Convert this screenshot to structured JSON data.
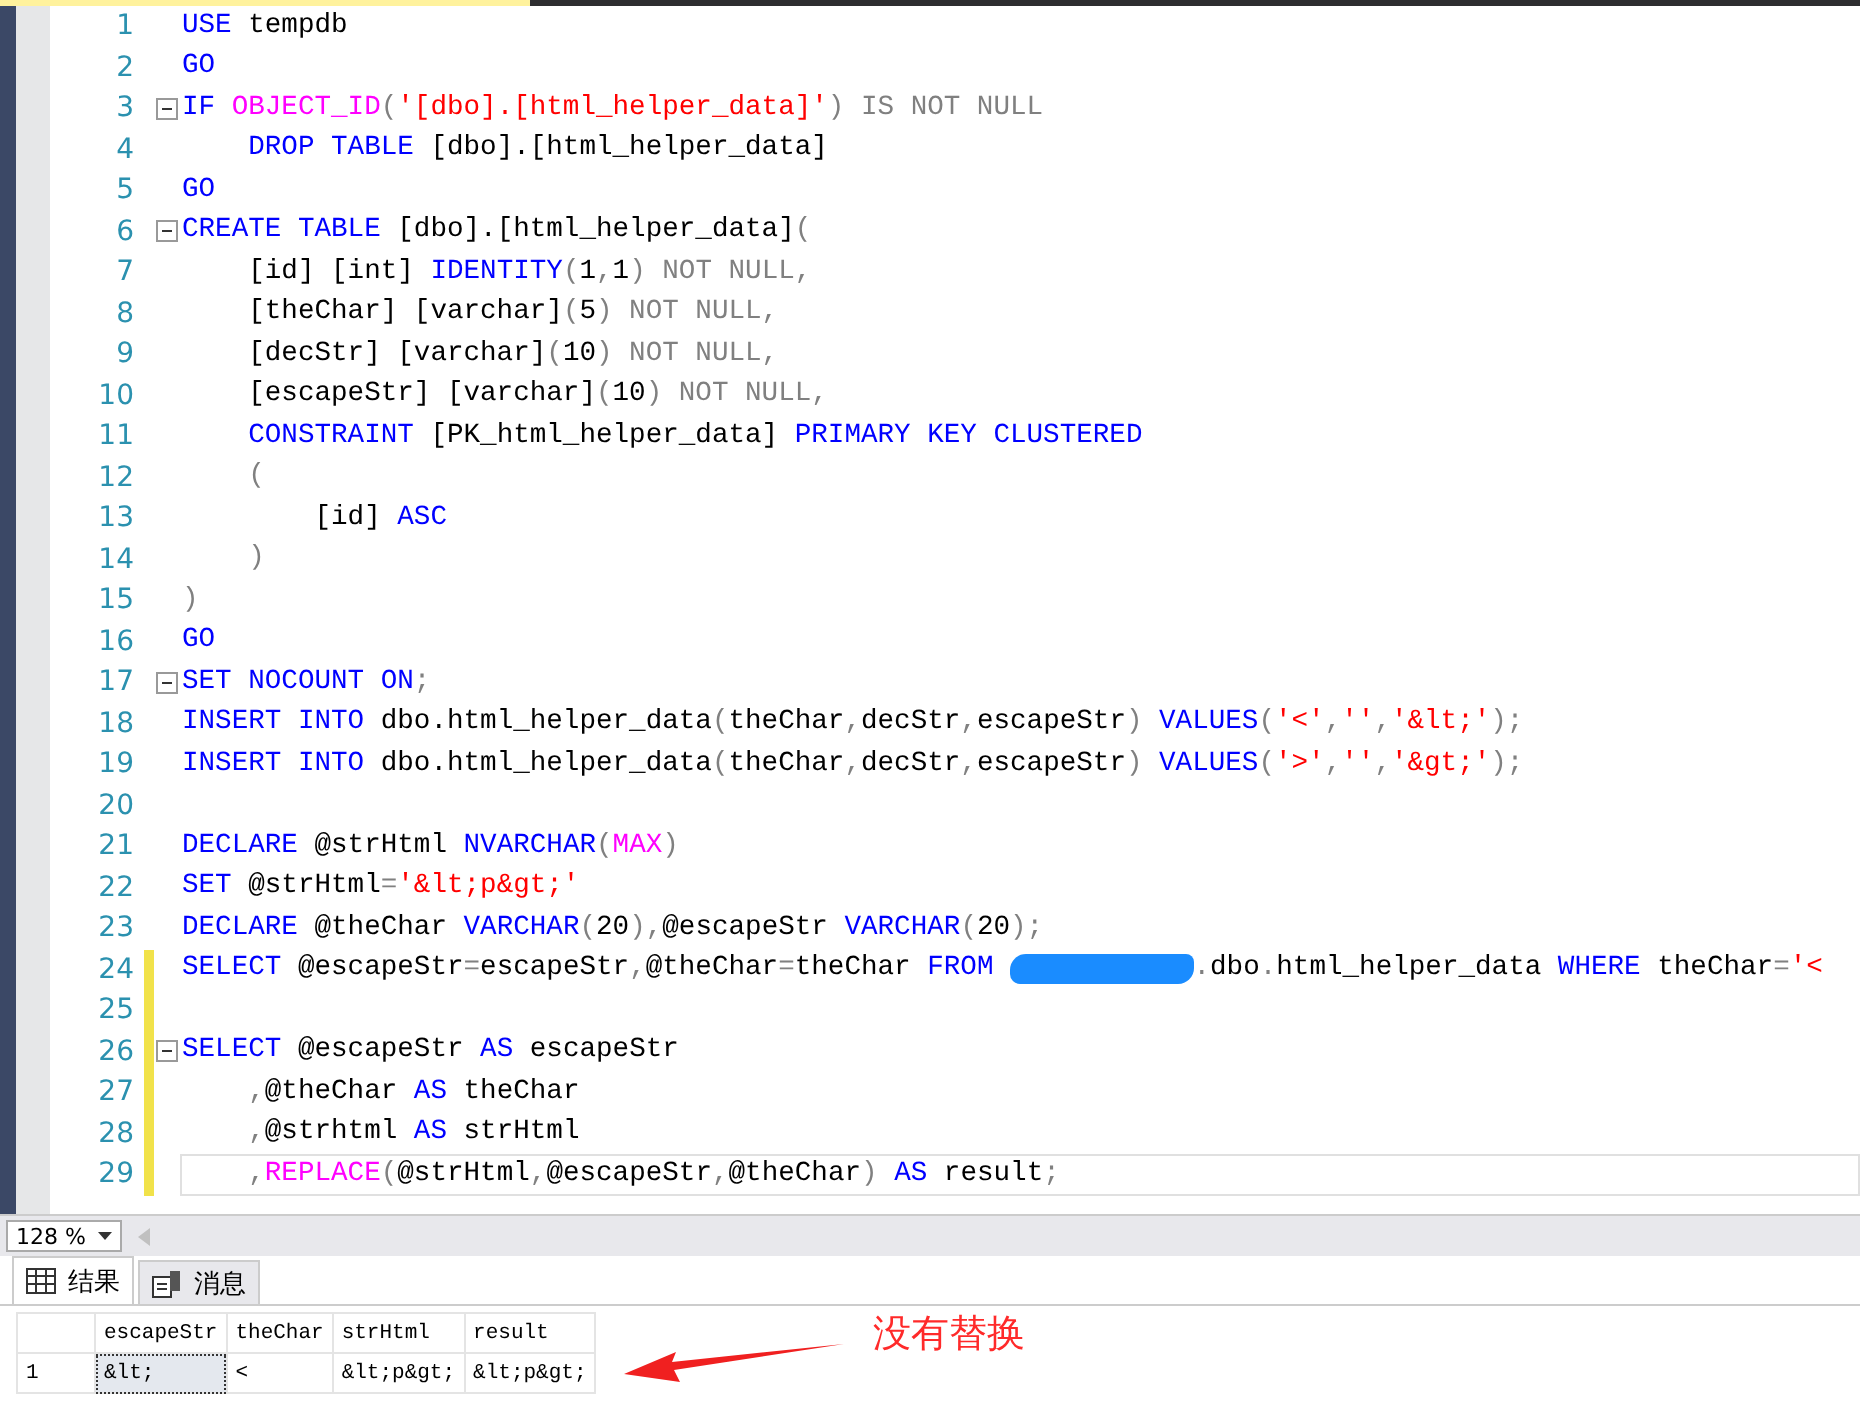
{
  "editor": {
    "lines": [
      {
        "number": "1",
        "fold": false,
        "changed": false,
        "current": false,
        "tokens": [
          {
            "kind": "keyword",
            "text": "USE"
          },
          {
            "kind": "plain",
            "text": " tempdb"
          }
        ]
      },
      {
        "number": "2",
        "fold": false,
        "changed": false,
        "current": false,
        "tokens": [
          {
            "kind": "keyword",
            "text": "GO"
          }
        ]
      },
      {
        "number": "3",
        "fold": true,
        "changed": false,
        "current": false,
        "tokens": [
          {
            "kind": "keyword",
            "text": "IF "
          },
          {
            "kind": "function",
            "text": "OBJECT_ID"
          },
          {
            "kind": "gray",
            "text": "("
          },
          {
            "kind": "string",
            "text": "'[dbo].[html_helper_data]'"
          },
          {
            "kind": "gray",
            "text": ") IS NOT NULL"
          }
        ]
      },
      {
        "number": "4",
        "fold": false,
        "changed": false,
        "current": false,
        "tokens": [
          {
            "kind": "keyword",
            "text": "    DROP TABLE"
          },
          {
            "kind": "plain",
            "text": " [dbo].[html_helper_data]"
          }
        ]
      },
      {
        "number": "5",
        "fold": false,
        "changed": false,
        "current": false,
        "tokens": [
          {
            "kind": "keyword",
            "text": "GO"
          }
        ]
      },
      {
        "number": "6",
        "fold": true,
        "changed": false,
        "current": false,
        "tokens": [
          {
            "kind": "keyword",
            "text": "CREATE TABLE"
          },
          {
            "kind": "plain",
            "text": " [dbo].[html_helper_data]"
          },
          {
            "kind": "gray",
            "text": "("
          }
        ]
      },
      {
        "number": "7",
        "fold": false,
        "changed": false,
        "current": false,
        "tokens": [
          {
            "kind": "plain",
            "text": "    [id] [int] "
          },
          {
            "kind": "keyword",
            "text": "IDENTITY"
          },
          {
            "kind": "gray",
            "text": "("
          },
          {
            "kind": "plain",
            "text": "1"
          },
          {
            "kind": "gray",
            "text": ","
          },
          {
            "kind": "plain",
            "text": "1"
          },
          {
            "kind": "gray",
            "text": ") NOT NULL,"
          }
        ]
      },
      {
        "number": "8",
        "fold": false,
        "changed": false,
        "current": false,
        "tokens": [
          {
            "kind": "plain",
            "text": "    [theChar] [varchar]"
          },
          {
            "kind": "gray",
            "text": "("
          },
          {
            "kind": "plain",
            "text": "5"
          },
          {
            "kind": "gray",
            "text": ") NOT NULL,"
          }
        ]
      },
      {
        "number": "9",
        "fold": false,
        "changed": false,
        "current": false,
        "tokens": [
          {
            "kind": "plain",
            "text": "    [decStr] [varchar]"
          },
          {
            "kind": "gray",
            "text": "("
          },
          {
            "kind": "plain",
            "text": "10"
          },
          {
            "kind": "gray",
            "text": ") NOT NULL,"
          }
        ]
      },
      {
        "number": "10",
        "fold": false,
        "changed": false,
        "current": false,
        "tokens": [
          {
            "kind": "plain",
            "text": "    [escapeStr] [varchar]"
          },
          {
            "kind": "gray",
            "text": "("
          },
          {
            "kind": "plain",
            "text": "10"
          },
          {
            "kind": "gray",
            "text": ") NOT NULL,"
          }
        ]
      },
      {
        "number": "11",
        "fold": false,
        "changed": false,
        "current": false,
        "tokens": [
          {
            "kind": "keyword",
            "text": "    CONSTRAINT"
          },
          {
            "kind": "plain",
            "text": " [PK_html_helper_data] "
          },
          {
            "kind": "keyword",
            "text": "PRIMARY KEY CLUSTERED"
          }
        ]
      },
      {
        "number": "12",
        "fold": false,
        "changed": false,
        "current": false,
        "tokens": [
          {
            "kind": "gray",
            "text": "    ("
          }
        ]
      },
      {
        "number": "13",
        "fold": false,
        "changed": false,
        "current": false,
        "tokens": [
          {
            "kind": "plain",
            "text": "        [id] "
          },
          {
            "kind": "keyword",
            "text": "ASC"
          }
        ]
      },
      {
        "number": "14",
        "fold": false,
        "changed": false,
        "current": false,
        "tokens": [
          {
            "kind": "gray",
            "text": "    )"
          }
        ]
      },
      {
        "number": "15",
        "fold": false,
        "changed": false,
        "current": false,
        "tokens": [
          {
            "kind": "gray",
            "text": ")"
          }
        ]
      },
      {
        "number": "16",
        "fold": false,
        "changed": false,
        "current": false,
        "tokens": [
          {
            "kind": "keyword",
            "text": "GO"
          }
        ]
      },
      {
        "number": "17",
        "fold": true,
        "changed": false,
        "current": false,
        "tokens": [
          {
            "kind": "keyword",
            "text": "SET NOCOUNT ON"
          },
          {
            "kind": "gray",
            "text": ";"
          }
        ]
      },
      {
        "number": "18",
        "fold": false,
        "changed": false,
        "current": false,
        "tokens": [
          {
            "kind": "keyword",
            "text": "INSERT INTO"
          },
          {
            "kind": "plain",
            "text": " dbo.html_helper_data"
          },
          {
            "kind": "gray",
            "text": "("
          },
          {
            "kind": "plain",
            "text": "theChar"
          },
          {
            "kind": "gray",
            "text": ","
          },
          {
            "kind": "plain",
            "text": "decStr"
          },
          {
            "kind": "gray",
            "text": ","
          },
          {
            "kind": "plain",
            "text": "escapeStr"
          },
          {
            "kind": "gray",
            "text": ") "
          },
          {
            "kind": "keyword",
            "text": "VALUES"
          },
          {
            "kind": "gray",
            "text": "("
          },
          {
            "kind": "string",
            "text": "'<'"
          },
          {
            "kind": "gray",
            "text": ","
          },
          {
            "kind": "string",
            "text": "''"
          },
          {
            "kind": "gray",
            "text": ","
          },
          {
            "kind": "string",
            "text": "'&lt;'"
          },
          {
            "kind": "gray",
            "text": ");"
          }
        ]
      },
      {
        "number": "19",
        "fold": false,
        "changed": false,
        "current": false,
        "tokens": [
          {
            "kind": "keyword",
            "text": "INSERT INTO"
          },
          {
            "kind": "plain",
            "text": " dbo.html_helper_data"
          },
          {
            "kind": "gray",
            "text": "("
          },
          {
            "kind": "plain",
            "text": "theChar"
          },
          {
            "kind": "gray",
            "text": ","
          },
          {
            "kind": "plain",
            "text": "decStr"
          },
          {
            "kind": "gray",
            "text": ","
          },
          {
            "kind": "plain",
            "text": "escapeStr"
          },
          {
            "kind": "gray",
            "text": ") "
          },
          {
            "kind": "keyword",
            "text": "VALUES"
          },
          {
            "kind": "gray",
            "text": "("
          },
          {
            "kind": "string",
            "text": "'>'"
          },
          {
            "kind": "gray",
            "text": ","
          },
          {
            "kind": "string",
            "text": "''"
          },
          {
            "kind": "gray",
            "text": ","
          },
          {
            "kind": "string",
            "text": "'&gt;'"
          },
          {
            "kind": "gray",
            "text": ");"
          }
        ]
      },
      {
        "number": "20",
        "fold": false,
        "changed": false,
        "current": false
      },
      {
        "number": "21",
        "fold": false,
        "changed": false,
        "current": false,
        "tokens": [
          {
            "kind": "keyword",
            "text": "DECLARE"
          },
          {
            "kind": "plain",
            "text": " @strHtml "
          },
          {
            "kind": "keyword",
            "text": "NVARCHAR"
          },
          {
            "kind": "gray",
            "text": "("
          },
          {
            "kind": "function",
            "text": "MAX"
          },
          {
            "kind": "gray",
            "text": ")"
          }
        ]
      },
      {
        "number": "22",
        "fold": false,
        "changed": false,
        "current": false,
        "tokens": [
          {
            "kind": "keyword",
            "text": "SET"
          },
          {
            "kind": "plain",
            "text": " @strHtml"
          },
          {
            "kind": "gray",
            "text": "="
          },
          {
            "kind": "string",
            "text": "'&lt;p&gt;'"
          }
        ]
      },
      {
        "number": "23",
        "fold": false,
        "changed": false,
        "current": false,
        "tokens": [
          {
            "kind": "keyword",
            "text": "DECLARE"
          },
          {
            "kind": "plain",
            "text": " @theChar "
          },
          {
            "kind": "keyword",
            "text": "VARCHAR"
          },
          {
            "kind": "gray",
            "text": "("
          },
          {
            "kind": "plain",
            "text": "20"
          },
          {
            "kind": "gray",
            "text": "),"
          },
          {
            "kind": "plain",
            "text": "@escapeStr "
          },
          {
            "kind": "keyword",
            "text": "VARCHAR"
          },
          {
            "kind": "gray",
            "text": "("
          },
          {
            "kind": "plain",
            "text": "20"
          },
          {
            "kind": "gray",
            "text": ");"
          }
        ]
      },
      {
        "number": "24",
        "fold": false,
        "changed": true,
        "current": false,
        "tokens": [
          {
            "kind": "keyword",
            "text": "SELECT"
          },
          {
            "kind": "plain",
            "text": " @escapeStr"
          },
          {
            "kind": "gray",
            "text": "="
          },
          {
            "kind": "plain",
            "text": "escapeStr"
          },
          {
            "kind": "gray",
            "text": ","
          },
          {
            "kind": "plain",
            "text": "@theChar"
          },
          {
            "kind": "gray",
            "text": "="
          },
          {
            "kind": "plain",
            "text": "theChar "
          },
          {
            "kind": "keyword",
            "text": "FROM"
          },
          {
            "kind": "redaction"
          },
          {
            "kind": "gray",
            "text": "."
          },
          {
            "kind": "plain",
            "text": "dbo"
          },
          {
            "kind": "gray",
            "text": "."
          },
          {
            "kind": "plain",
            "text": "html_helper_data "
          },
          {
            "kind": "keyword",
            "text": "WHERE"
          },
          {
            "kind": "plain",
            "text": " theChar"
          },
          {
            "kind": "gray",
            "text": "="
          },
          {
            "kind": "string",
            "text": "'<"
          }
        ]
      },
      {
        "number": "25",
        "fold": false,
        "changed": true,
        "current": false
      },
      {
        "number": "26",
        "fold": true,
        "changed": true,
        "current": false,
        "tokens": [
          {
            "kind": "keyword",
            "text": "SELECT"
          },
          {
            "kind": "plain",
            "text": " @escapeStr "
          },
          {
            "kind": "keyword",
            "text": "AS"
          },
          {
            "kind": "plain",
            "text": " escapeStr"
          }
        ]
      },
      {
        "number": "27",
        "fold": false,
        "changed": true,
        "current": false,
        "tokens": [
          {
            "kind": "gray",
            "text": "    ,"
          },
          {
            "kind": "plain",
            "text": "@theChar "
          },
          {
            "kind": "keyword",
            "text": "AS"
          },
          {
            "kind": "plain",
            "text": " theChar"
          }
        ]
      },
      {
        "number": "28",
        "fold": false,
        "changed": true,
        "current": false,
        "tokens": [
          {
            "kind": "gray",
            "text": "    ,"
          },
          {
            "kind": "plain",
            "text": "@strhtml "
          },
          {
            "kind": "keyword",
            "text": "AS"
          },
          {
            "kind": "plain",
            "text": " strHtml"
          }
        ]
      },
      {
        "number": "29",
        "fold": false,
        "changed": true,
        "current": true,
        "tokens": [
          {
            "kind": "gray",
            "text": "    ,"
          },
          {
            "kind": "function",
            "text": "REPLACE"
          },
          {
            "kind": "gray",
            "text": "("
          },
          {
            "kind": "plain",
            "text": "@strHtml"
          },
          {
            "kind": "gray",
            "text": ","
          },
          {
            "kind": "plain",
            "text": "@escapeStr"
          },
          {
            "kind": "gray",
            "text": ","
          },
          {
            "kind": "plain",
            "text": "@theChar"
          },
          {
            "kind": "gray",
            "text": ") "
          },
          {
            "kind": "keyword",
            "text": "AS"
          },
          {
            "kind": "plain",
            "text": " result"
          },
          {
            "kind": "gray",
            "text": ";"
          }
        ]
      }
    ]
  },
  "zoom": {
    "value": "128 %"
  },
  "tabs": [
    {
      "label": "结果",
      "selected": true
    },
    {
      "label": "消息",
      "selected": false
    }
  ],
  "results": {
    "columns": [
      "escapeStr",
      "theChar",
      "strHtml",
      "result"
    ],
    "rows": [
      {
        "number": "1",
        "cells": [
          {
            "text": "&lt;",
            "selected": true
          },
          {
            "text": "<",
            "selected": false
          },
          {
            "text": "&lt;p&gt;",
            "selected": false
          },
          {
            "text": "&lt;p&gt;",
            "selected": false
          }
        ]
      }
    ]
  },
  "annotation": {
    "text": "没有替换"
  }
}
